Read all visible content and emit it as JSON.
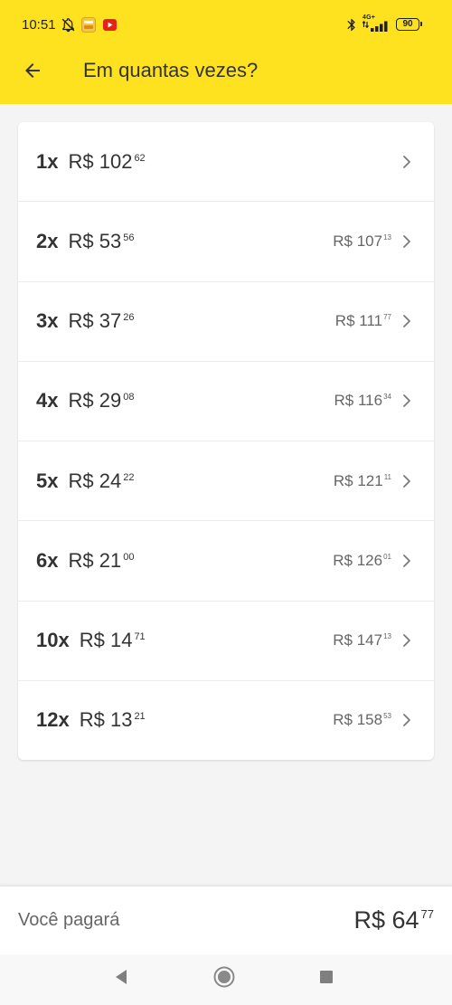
{
  "status_bar": {
    "time": "10:51",
    "network": "4G+",
    "battery": "90",
    "icons": [
      "bell-off-icon",
      "app-notification-icon",
      "youtube-icon",
      "bluetooth-icon",
      "signal-icon",
      "battery-icon"
    ]
  },
  "header": {
    "back_icon": "arrow-left-icon",
    "title": "Em quantas vezes?"
  },
  "installments": [
    {
      "count": "1x",
      "amount": "R$ 102",
      "cents": "62"
    },
    {
      "count": "2x",
      "amount": "R$ 53",
      "cents": "56",
      "total": "R$ 107",
      "total_cents": "13"
    },
    {
      "count": "3x",
      "amount": "R$ 37",
      "cents": "26",
      "total": "R$ 111",
      "total_cents": "77"
    },
    {
      "count": "4x",
      "amount": "R$ 29",
      "cents": "08",
      "total": "R$ 116",
      "total_cents": "34"
    },
    {
      "count": "5x",
      "amount": "R$ 24",
      "cents": "22",
      "total": "R$ 121",
      "total_cents": "11"
    },
    {
      "count": "6x",
      "amount": "R$ 21",
      "cents": "00",
      "total": "R$ 126",
      "total_cents": "01"
    },
    {
      "count": "10x",
      "amount": "R$ 14",
      "cents": "71",
      "total": "R$ 147",
      "total_cents": "13"
    },
    {
      "count": "12x",
      "amount": "R$ 13",
      "cents": "21",
      "total": "R$ 158",
      "total_cents": "53"
    }
  ],
  "footer": {
    "label": "Você pagará",
    "amount": "R$ 64",
    "cents": "77"
  },
  "nav_bar": {
    "icons": [
      "nav-back-icon",
      "nav-home-icon",
      "nav-recents-icon"
    ]
  },
  "colors": {
    "brand_yellow": "#FFE21F",
    "background": "#F4F4F4",
    "card": "#FFFFFF",
    "primary_text": "#333333",
    "secondary_text": "#666666"
  }
}
